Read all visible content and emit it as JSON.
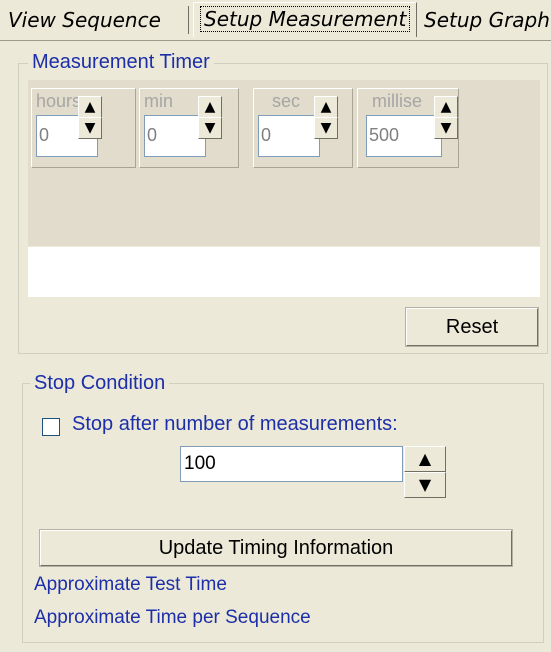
{
  "tabs": [
    {
      "label": "View Sequence"
    },
    {
      "label": "Setup Measurement"
    },
    {
      "label": "Setup Graph"
    }
  ],
  "timer_group": {
    "title": "Measurement Timer",
    "fields": [
      {
        "label": "hours",
        "value": "0"
      },
      {
        "label": "min",
        "value": "0"
      },
      {
        "label": "sec",
        "value": "0"
      },
      {
        "label": "millise",
        "value": "500"
      }
    ],
    "reset_label": "Reset"
  },
  "stop_group": {
    "title": "Stop Condition",
    "checkbox_label": "Stop after number of measurements:",
    "checkbox_checked": false,
    "count_value": "100",
    "update_label": "Update Timing Information",
    "info_lines": [
      "Approximate Test Time",
      "Approximate Time per Sequence"
    ]
  }
}
